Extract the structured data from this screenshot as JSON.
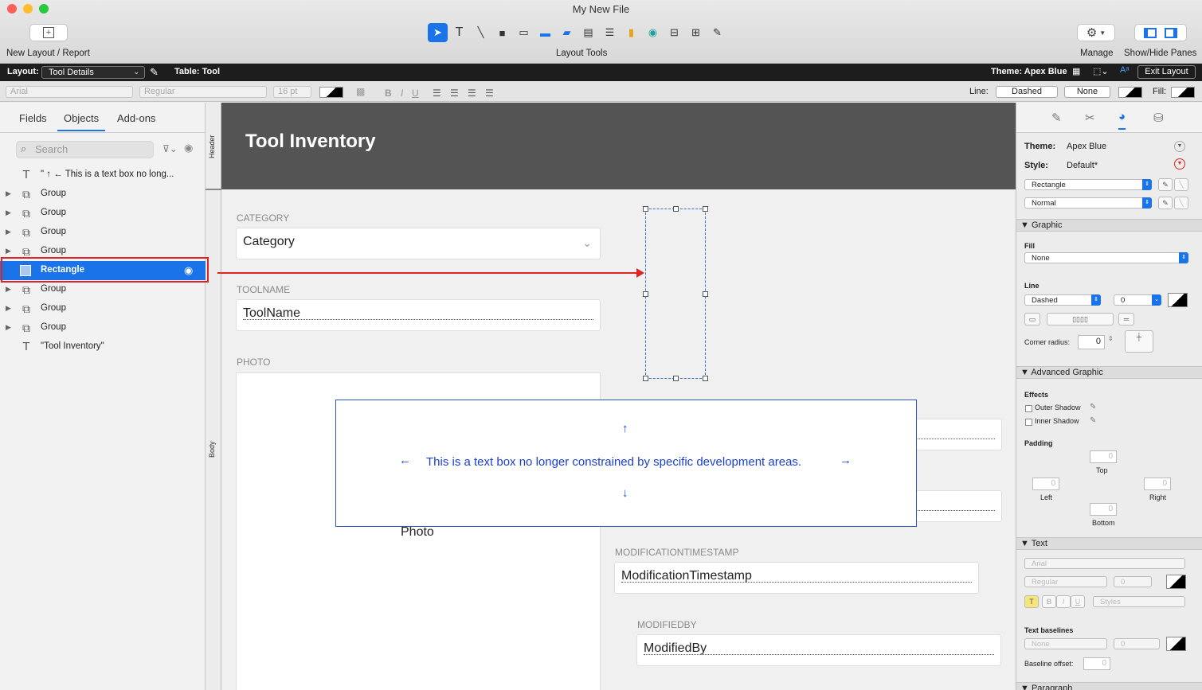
{
  "window": {
    "title": "My New File"
  },
  "toolbar": {
    "new_layout_label": "New Layout / Report",
    "layout_tools_label": "Layout Tools",
    "manage_label": "Manage",
    "show_hide_label": "Show/Hide Panes"
  },
  "layoutbar": {
    "layout_label": "Layout:",
    "layout_value": "Tool Details",
    "table_label": "Table: Tool",
    "theme_label": "Theme: Apex Blue",
    "exit_label": "Exit Layout"
  },
  "formatbar": {
    "font": "Arial",
    "style": "Regular",
    "size": "16 pt",
    "line_label": "Line:",
    "line_style": "Dashed",
    "line_width": "None",
    "fill_label": "Fill:"
  },
  "leftpane": {
    "tabs": [
      "Fields",
      "Objects",
      "Add-ons"
    ],
    "search_placeholder": "Search",
    "objects": [
      {
        "label": "\" ↑ ← This is a text box no long...",
        "type": "text"
      },
      {
        "label": "Group",
        "type": "group"
      },
      {
        "label": "Group",
        "type": "group"
      },
      {
        "label": "Group",
        "type": "group"
      },
      {
        "label": "Group",
        "type": "group"
      },
      {
        "label": "Rectangle",
        "type": "rect",
        "selected": true
      },
      {
        "label": "Group",
        "type": "group"
      },
      {
        "label": "Group",
        "type": "group"
      },
      {
        "label": "Group",
        "type": "group"
      },
      {
        "label": "\"Tool Inventory\"",
        "type": "text"
      }
    ]
  },
  "parts": {
    "header": "Header",
    "body": "Body"
  },
  "canvas": {
    "title": "Tool Inventory",
    "category_label": "CATEGORY",
    "category_value": "Category",
    "toolname_label": "TOOLNAME",
    "toolname_value": "ToolName",
    "photo_label": "PHOTO",
    "photo_value": "Photo",
    "modts_label": "MODIFICATIONTIMESTAMP",
    "modts_value": "ModificationTimestamp",
    "modby_label": "MODIFIEDBY",
    "modby_value": "ModifiedBy",
    "textbox": {
      "up": "↑",
      "left": "←",
      "text": "This is a text box no longer constrained by specific development areas.",
      "right": "→",
      "down": "↓"
    }
  },
  "inspector": {
    "theme_label": "Theme:",
    "theme_value": "Apex Blue",
    "style_label": "Style:",
    "style_value": "Default*",
    "object_select": "Rectangle",
    "state_select": "Normal",
    "graphic_section": "Graphic",
    "fill_label": "Fill",
    "fill_value": "None",
    "line_label": "Line",
    "line_value": "Dashed",
    "line_width": "0",
    "corner_radius_label": "Corner radius:",
    "corner_radius_value": "0",
    "advanced_section": "Advanced Graphic",
    "effects_label": "Effects",
    "outer_shadow": "Outer Shadow",
    "inner_shadow": "Inner Shadow",
    "padding_label": "Padding",
    "pad_top": "0",
    "pad_top_label": "Top",
    "pad_left": "0",
    "pad_left_label": "Left",
    "pad_right": "0",
    "pad_right_label": "Right",
    "pad_bottom": "0",
    "pad_bottom_label": "Bottom",
    "text_section": "Text",
    "text_font": "Arial",
    "text_style": "Regular",
    "text_size": "0",
    "styles_select": "Styles",
    "baselines_label": "Text baselines",
    "baselines_value": "None",
    "baselines_size": "0",
    "baseline_offset_label": "Baseline offset:",
    "baseline_offset_value": "0",
    "paragraph_section": "Paragraph"
  },
  "colors": {
    "accent": "#1a73e8",
    "annotation": "#e02424",
    "header_band": "#545454"
  }
}
